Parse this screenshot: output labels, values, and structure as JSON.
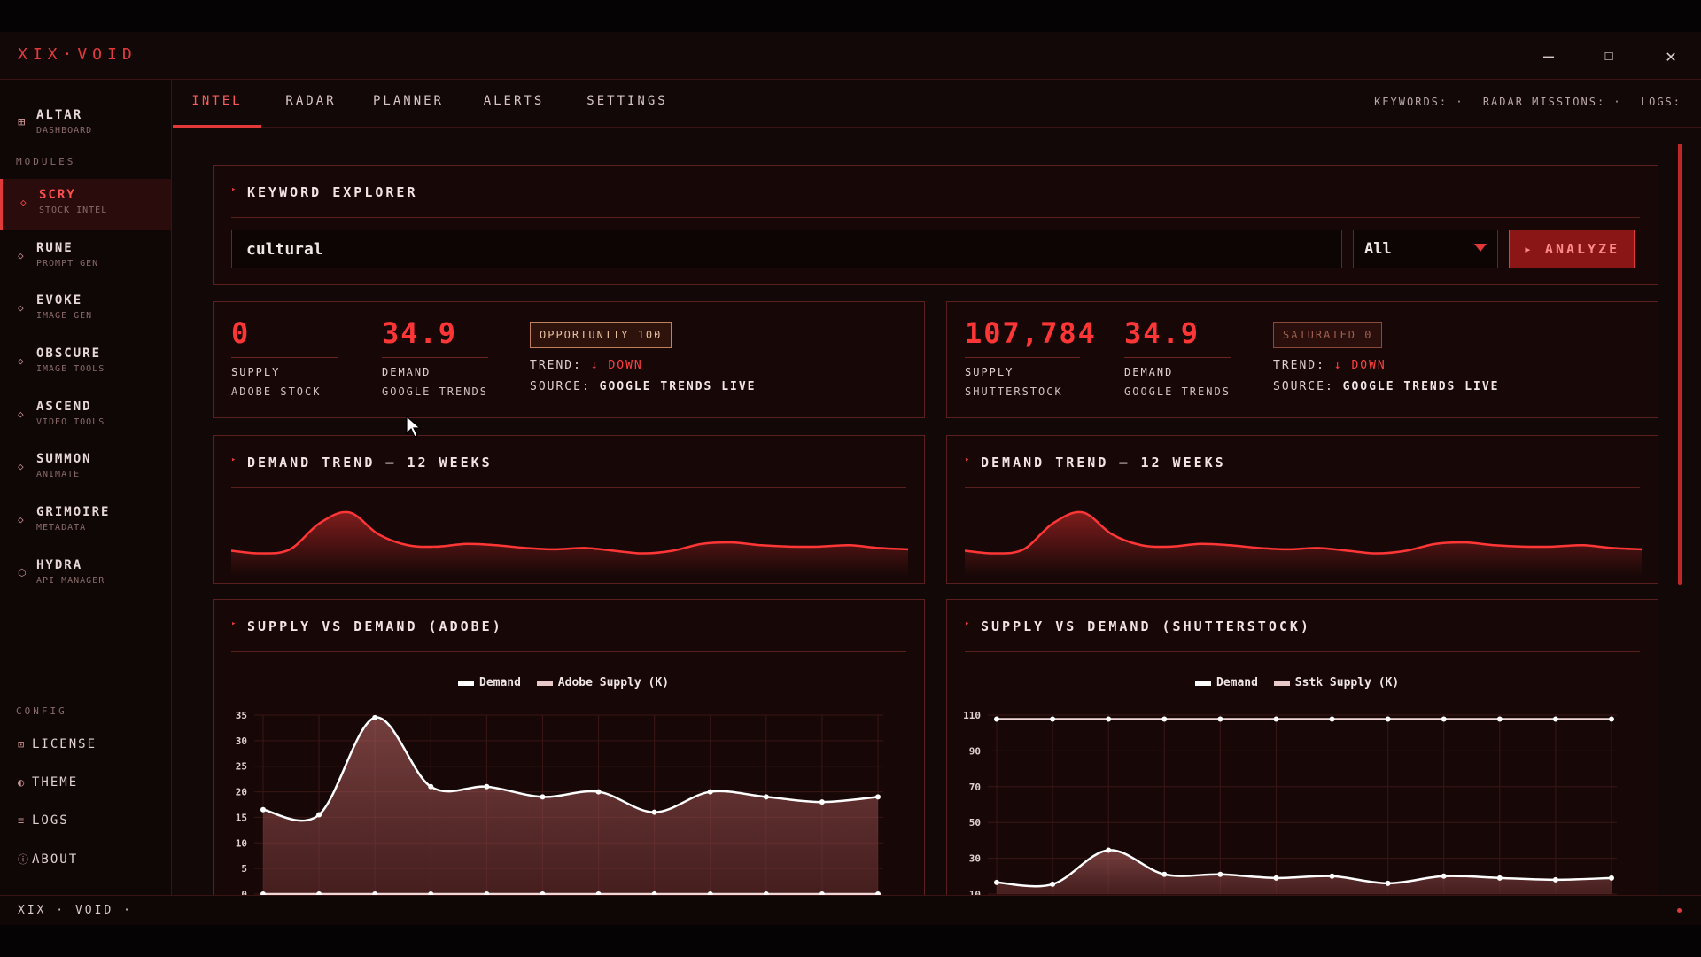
{
  "window": {
    "brand": "XIX·VOID",
    "minimize": "—",
    "maximize": "☐",
    "close": "✕"
  },
  "sidebar": {
    "top": {
      "label": "ALTAR",
      "sub": "DASHBOARD",
      "icon": "grid-icon"
    },
    "modules_label": "MODULES",
    "items": [
      {
        "label": "SCRY",
        "sub": "STOCK INTEL",
        "active": true
      },
      {
        "label": "RUNE",
        "sub": "PROMPT GEN"
      },
      {
        "label": "EVOKE",
        "sub": "IMAGE GEN"
      },
      {
        "label": "OBSCURE",
        "sub": "IMAGE TOOLS"
      },
      {
        "label": "ASCEND",
        "sub": "VIDEO TOOLS"
      },
      {
        "label": "SUMMON",
        "sub": "ANIMATE"
      },
      {
        "label": "GRIMOIRE",
        "sub": "METADATA"
      },
      {
        "label": "HYDRA",
        "sub": "API MANAGER"
      }
    ],
    "config_label": "CONFIG",
    "config": [
      {
        "label": "LICENSE",
        "icon": "⊡"
      },
      {
        "label": "THEME",
        "icon": "◐"
      },
      {
        "label": "LOGS",
        "icon": "≡"
      },
      {
        "label": "ABOUT",
        "icon": "ⓘ"
      }
    ]
  },
  "tabs": [
    "INTEL",
    "RADAR",
    "PLANNER",
    "ALERTS",
    "SETTINGS"
  ],
  "status": {
    "keywords": "KEYWORDS: ·",
    "radar": "RADAR MISSIONS: ·",
    "logs": "LOGS:"
  },
  "explorer": {
    "title": "KEYWORD EXPLORER",
    "query": "cultural",
    "filter": "All",
    "analyze": "▸ ANALYZE"
  },
  "adobe": {
    "supply": "0",
    "supply_label": "SUPPLY",
    "supply_source": "ADOBE STOCK",
    "demand": "34.9",
    "demand_label": "DEMAND",
    "demand_source": "GOOGLE TRENDS",
    "badge": "OPPORTUNITY 100",
    "trend_label": "TREND:",
    "trend_value": "↓ DOWN",
    "source_label": "SOURCE:",
    "source_value": "GOOGLE TRENDS LIVE"
  },
  "shutter": {
    "supply": "107,784",
    "supply_label": "SUPPLY",
    "supply_source": "SHUTTERSTOCK",
    "demand": "34.9",
    "demand_label": "DEMAND",
    "demand_source": "GOOGLE TRENDS",
    "badge": "SATURATED 0",
    "trend_label": "TREND:",
    "trend_value": "↓ DOWN",
    "source_label": "SOURCE:",
    "source_value": "GOOGLE TRENDS LIVE"
  },
  "trend_panels": {
    "left_title": "DEMAND TREND — 12 WEEKS",
    "right_title": "DEMAND TREND — 12 WEEKS"
  },
  "sd_panels": {
    "left_title": "SUPPLY VS DEMAND (ADOBE)",
    "right_title": "SUPPLY VS DEMAND (SHUTTERSTOCK)",
    "left_legend": [
      "Demand",
      "Adobe Supply (K)"
    ],
    "right_legend": [
      "Demand",
      "Sstk Supply (K)"
    ]
  },
  "footer": {
    "text": "XIX · VOID ·"
  },
  "chart_data": [
    {
      "type": "area",
      "title": "",
      "series": [
        {
          "values": [
            16,
            15,
            16.5,
            26,
            30,
            22,
            18,
            17.5,
            18.5,
            18,
            17,
            16.5,
            17,
            16,
            15,
            16,
            18.5,
            19,
            18,
            17.5,
            17.5,
            18,
            17,
            16.5
          ]
        }
      ],
      "color": "#ff3636"
    },
    {
      "type": "area",
      "title": "",
      "series": [
        {
          "values": [
            16,
            15,
            16.5,
            26,
            30,
            22,
            18,
            17.5,
            18.5,
            18,
            17,
            16.5,
            17,
            16,
            15,
            16,
            18.5,
            19,
            18,
            17.5,
            17.5,
            18,
            17,
            16.5
          ]
        }
      ],
      "color": "#ff3636"
    },
    {
      "type": "line",
      "title": "SUPPLY VS DEMAND (ADOBE)",
      "ylim": [
        0,
        35
      ],
      "yticks": [
        0,
        5,
        10,
        15,
        20,
        25,
        30,
        35
      ],
      "series": [
        {
          "name": "Demand",
          "values": [
            16.5,
            15.5,
            34.5,
            21,
            21,
            19,
            20,
            16,
            20,
            19,
            18,
            19
          ]
        },
        {
          "name": "Adobe Supply (K)",
          "values": [
            0,
            0,
            0,
            0,
            0,
            0,
            0,
            0,
            0,
            0,
            0,
            0
          ]
        }
      ],
      "legend": "top-center"
    },
    {
      "type": "line",
      "title": "SUPPLY VS DEMAND (SHUTTERSTOCK)",
      "ylim": [
        10,
        110
      ],
      "yticks": [
        10,
        30,
        50,
        70,
        90,
        110
      ],
      "series": [
        {
          "name": "Demand",
          "values": [
            16.5,
            15.5,
            34.5,
            21,
            21,
            19,
            20,
            16,
            20,
            19,
            18,
            19
          ]
        },
        {
          "name": "Sstk Supply (K)",
          "values": [
            107.8,
            107.8,
            107.8,
            107.8,
            107.8,
            107.8,
            107.8,
            107.8,
            107.8,
            107.8,
            107.8,
            107.8
          ]
        }
      ],
      "legend": "top-center"
    }
  ]
}
